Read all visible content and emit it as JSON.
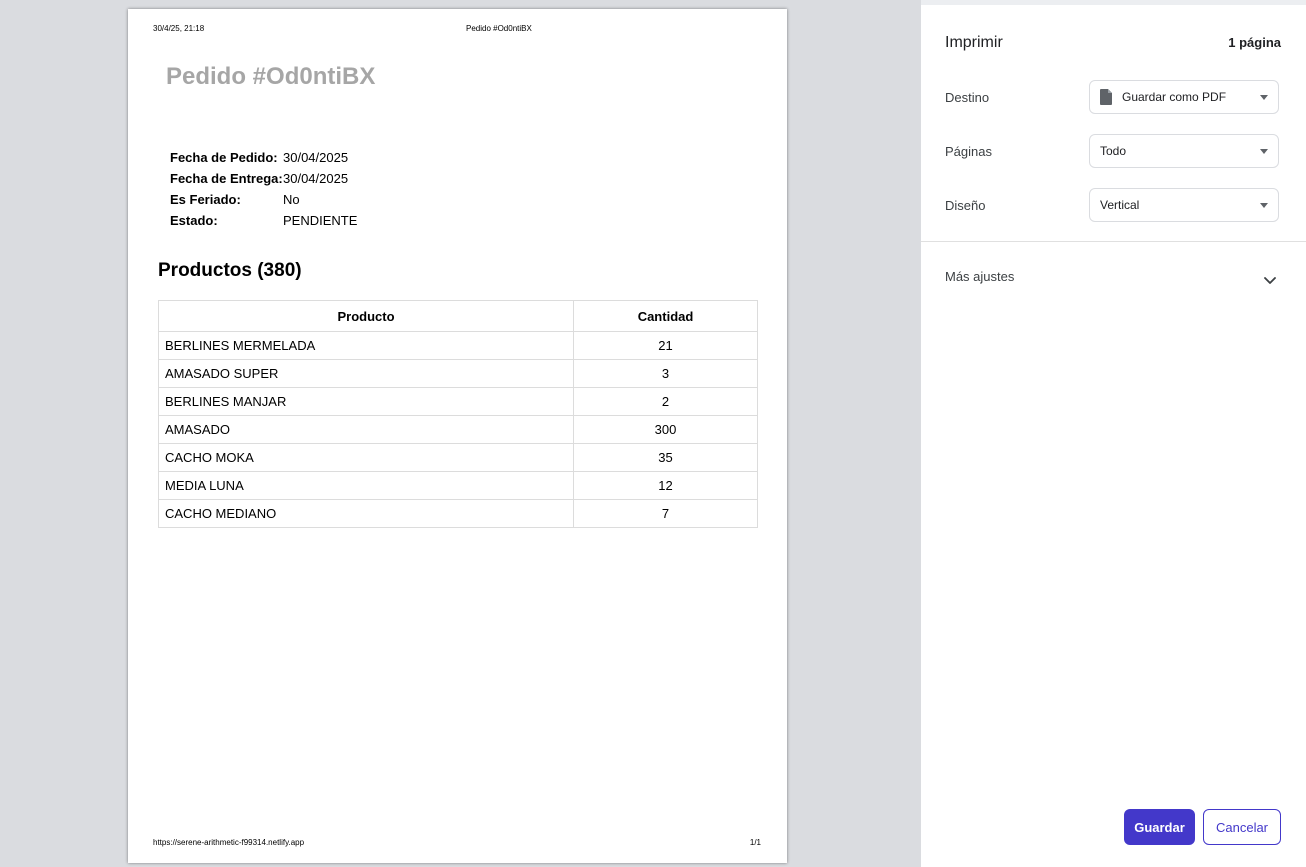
{
  "preview": {
    "header": {
      "datetime": "30/4/25, 21:18",
      "title": "Pedido #Od0ntiBX"
    },
    "footer": {
      "url": "https://serene-arithmetic-f99314.netlify.app",
      "pages": "1/1"
    },
    "order": {
      "title": "Pedido #Od0ntiBX",
      "info": [
        {
          "label": "Fecha de Pedido:",
          "value": "30/04/2025"
        },
        {
          "label": "Fecha de Entrega:",
          "value": "30/04/2025"
        },
        {
          "label": "Es Feriado:",
          "value": "No"
        },
        {
          "label": "Estado:",
          "value": "PENDIENTE"
        }
      ],
      "products_heading": "Productos (380)",
      "table": {
        "headers": [
          "Producto",
          "Cantidad"
        ],
        "rows": [
          [
            "BERLINES MERMELADA",
            "21"
          ],
          [
            "AMASADO SUPER",
            "3"
          ],
          [
            "BERLINES MANJAR",
            "2"
          ],
          [
            "AMASADO",
            "300"
          ],
          [
            "CACHO MOKA",
            "35"
          ],
          [
            "MEDIA LUNA",
            "12"
          ],
          [
            "CACHO MEDIANO",
            "7"
          ]
        ]
      }
    }
  },
  "panel": {
    "title": "Imprimir",
    "page_count": "1 página",
    "destination": {
      "label": "Destino",
      "value": "Guardar como PDF",
      "icon": "file-icon"
    },
    "pages": {
      "label": "Páginas",
      "value": "Todo"
    },
    "layout": {
      "label": "Diseño",
      "value": "Vertical"
    },
    "more_settings": {
      "label": "Más ajustes",
      "icon": "chevron-down-icon"
    },
    "buttons": {
      "save": "Guardar",
      "cancel": "Cancelar"
    }
  },
  "colors": {
    "accent": "#4338ca",
    "preview_background": "#dadce0",
    "title_gray": "#a6a6a6"
  }
}
